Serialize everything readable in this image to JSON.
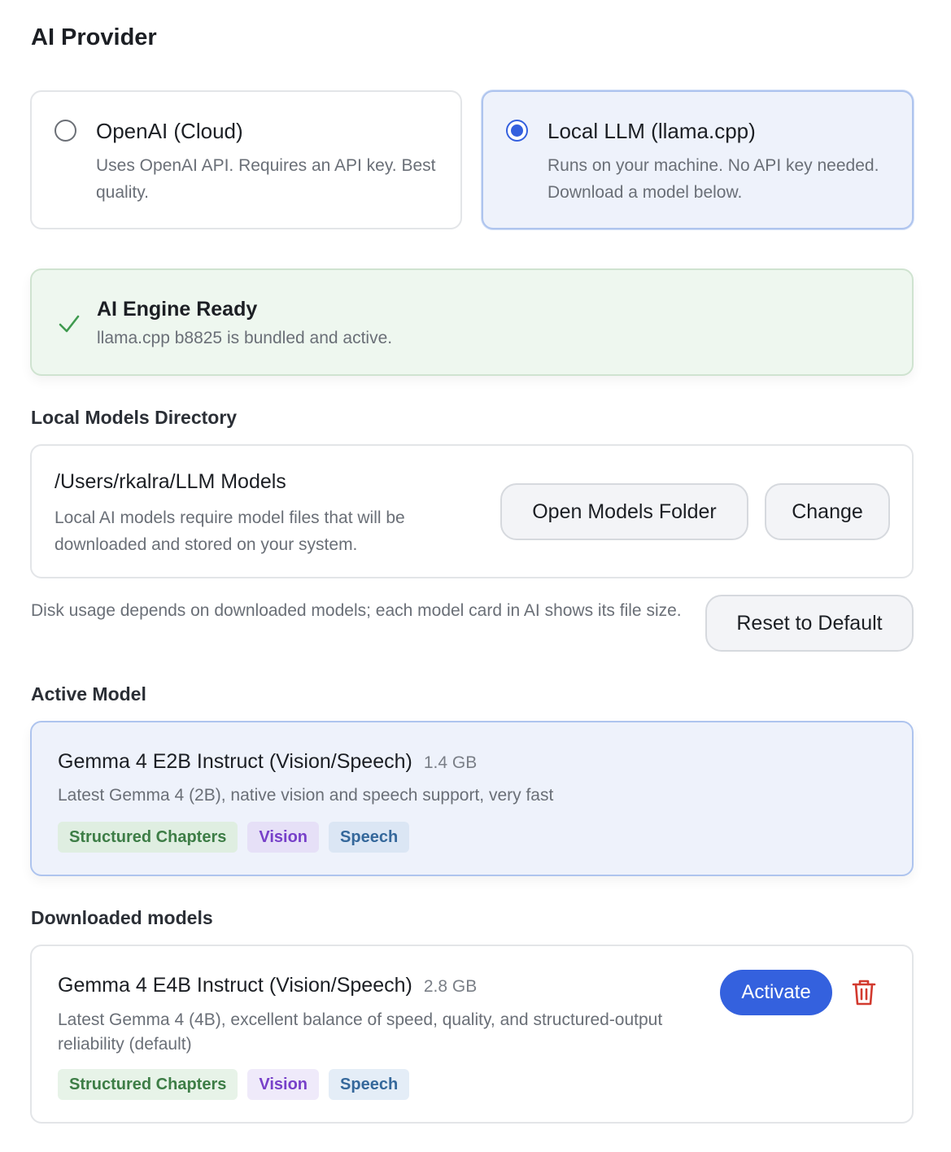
{
  "header": {
    "title": "AI Provider"
  },
  "providers": [
    {
      "title": "OpenAI (Cloud)",
      "description": "Uses OpenAI API. Requires an API key. Best quality.",
      "selected": false
    },
    {
      "title": "Local LLM (llama.cpp)",
      "description": "Runs on your machine. No API key needed. Download a model below.",
      "selected": true
    }
  ],
  "engine": {
    "title": "AI Engine Ready",
    "description": "llama.cpp b8825 is bundled and active.",
    "icon": "check-icon",
    "color": "#3f9a4f"
  },
  "directory": {
    "heading": "Local Models Directory",
    "path": "/Users/rkalra/LLM Models",
    "description": "Local AI models require model files that will be downloaded and stored on your system.",
    "open_button": "Open Models Folder",
    "change_button": "Change",
    "disk_note": "Disk usage depends on downloaded models; each model card in AI shows its file size.",
    "reset_button": "Reset to Default"
  },
  "active_model": {
    "heading": "Active Model",
    "name": "Gemma 4 E2B Instruct (Vision/Speech)",
    "size": "1.4 GB",
    "description": "Latest Gemma 4 (2B), native vision and speech support, very fast",
    "tags": [
      "Structured Chapters",
      "Vision",
      "Speech"
    ]
  },
  "downloaded": {
    "heading": "Downloaded models",
    "models": [
      {
        "name": "Gemma 4 E4B Instruct (Vision/Speech)",
        "size": "2.8 GB",
        "description": "Latest Gemma 4 (4B), excellent balance of speed, quality, and structured-output reliability (default)",
        "tags": [
          "Structured Chapters",
          "Vision",
          "Speech"
        ],
        "activate_label": "Activate",
        "delete_icon": "trash-icon"
      }
    ]
  },
  "colors": {
    "accent": "#3461de",
    "success": "#3f9a4f",
    "danger": "#d23a2f"
  }
}
